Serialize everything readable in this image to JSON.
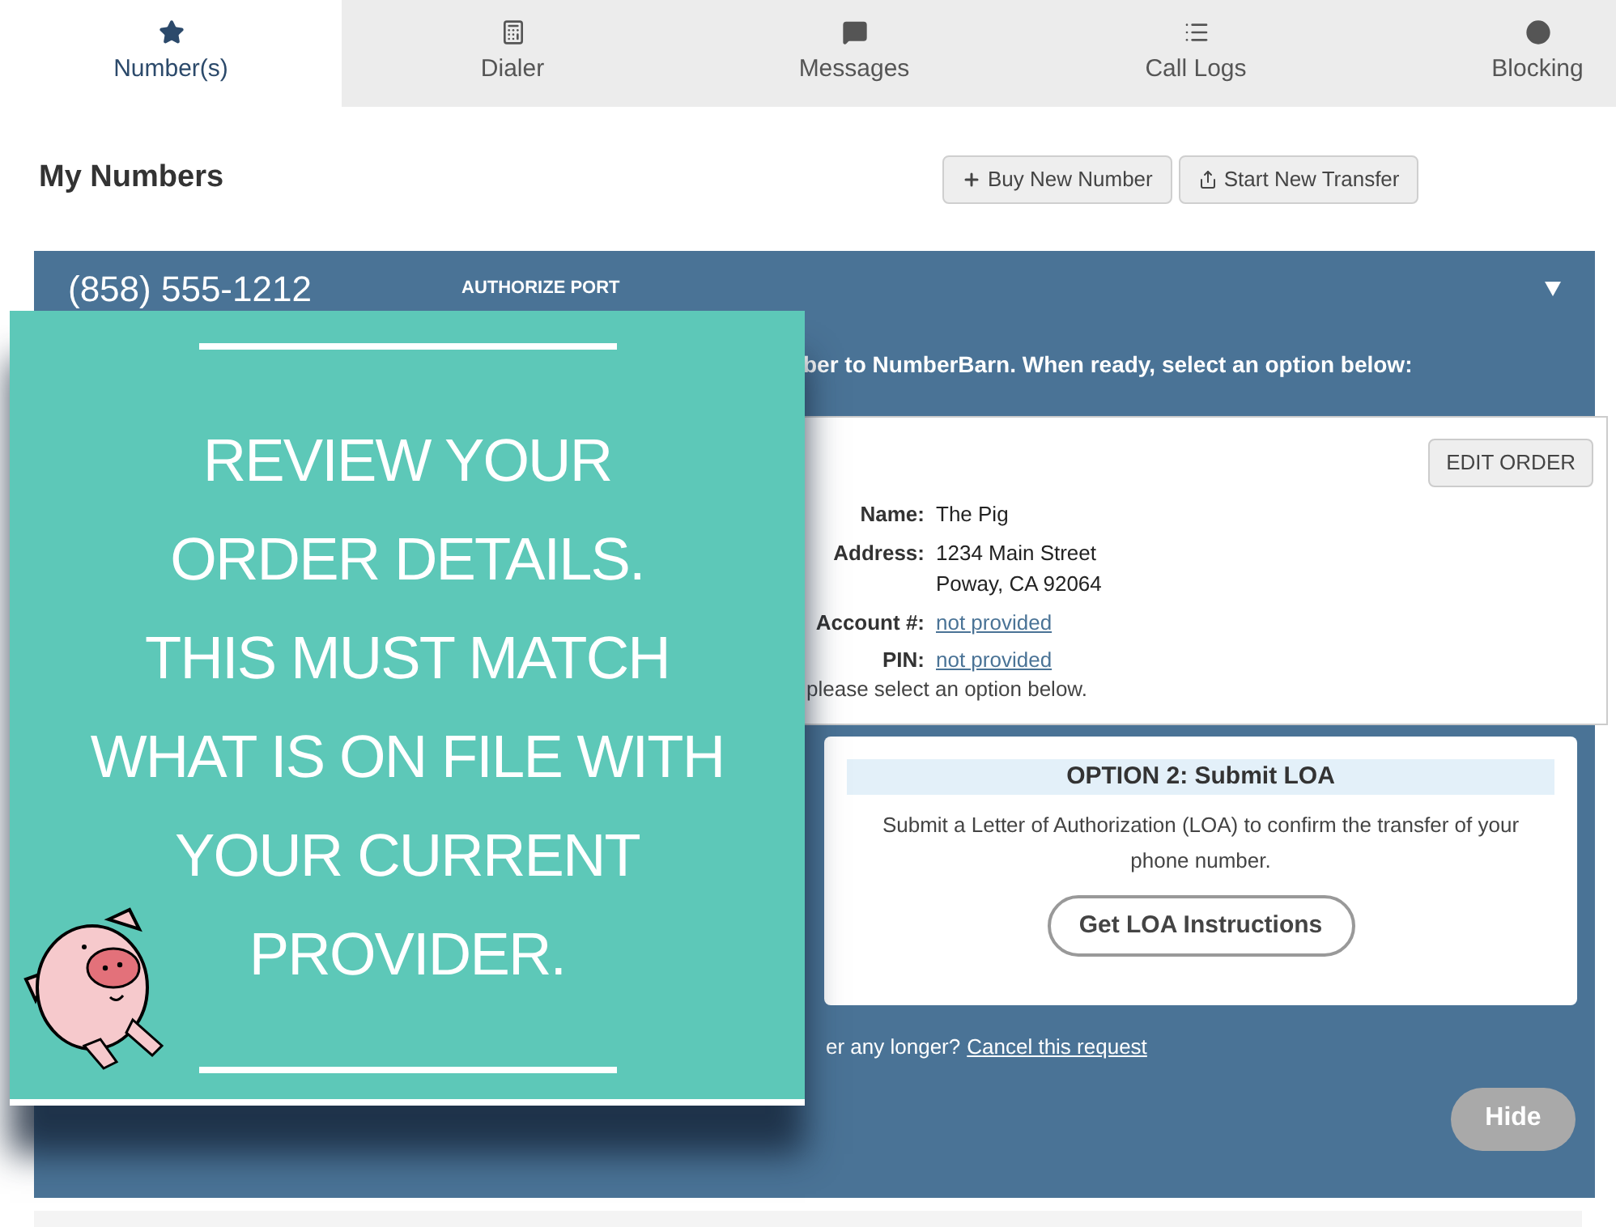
{
  "tabs": [
    {
      "label": "Number(s)",
      "selected": true
    },
    {
      "label": "Dialer",
      "selected": false
    },
    {
      "label": "Messages",
      "selected": false
    },
    {
      "label": "Call Logs",
      "selected": false
    },
    {
      "label": "Blocking",
      "selected": false
    }
  ],
  "heading": "My Numbers",
  "toolbar": [
    {
      "label": "Buy New Number",
      "kind": "plus"
    },
    {
      "label": "Start New Transfer",
      "kind": "share"
    }
  ],
  "panel": {
    "number": "(858) 555-1212",
    "status": "AUTHORIZE PORT",
    "expanded": true,
    "instructions": "ber to NumberBarn. When ready, select an option below:",
    "order": {
      "edit_button": "EDIT ORDER",
      "fields": [
        {
          "label": "Name:",
          "value": "The Pig",
          "kind": "text"
        },
        {
          "label": "Address:",
          "value": "1234 Main Street",
          "value_2": "Poway, CA 92064",
          "kind": "text"
        },
        {
          "label": "Account #:",
          "value": "not provided",
          "kind": "link"
        },
        {
          "label": "PIN:",
          "value": "not provided",
          "kind": "link"
        }
      ],
      "note": "please select an option below."
    },
    "option": {
      "title": "OPTION 2: Submit LOA",
      "text": "Submit a Letter of Authorization (LOA) to confirm the transfer of your phone number.",
      "button": "Get LOA Instructions"
    },
    "cancel_prefix": "er any longer?",
    "cancel_link": "Cancel this request",
    "hide_button": "Hide"
  },
  "overlay": {
    "lines": [
      "REVIEW YOUR",
      "ORDER DETAILS.",
      "THIS MUST MATCH",
      "WHAT IS ON FILE WITH",
      "YOUR CURRENT",
      "PROVIDER."
    ]
  }
}
